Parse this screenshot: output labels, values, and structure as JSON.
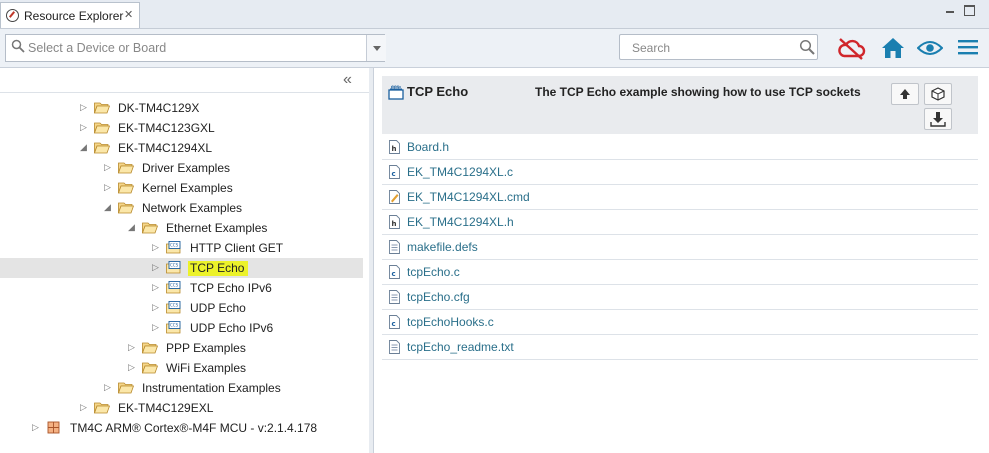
{
  "tab": {
    "title": "Resource Explorer",
    "close_glyph": "✕"
  },
  "window": {
    "minimize_icon": "minimize-icon",
    "maximize_icon": "maximize-icon"
  },
  "toolbar": {
    "device_placeholder": "Select a Device or Board",
    "search_placeholder": "Search",
    "icons": [
      "search-icon",
      "cloud-offline-icon",
      "home-icon",
      "eye-icon",
      "menu-icon"
    ],
    "colors": {
      "accent_blue": "#1a7fb0",
      "cloud_red": "#d0262b"
    }
  },
  "tree": {
    "collapse_glyph": "«",
    "items": [
      {
        "label": "DK-TM4C129X",
        "level": 3,
        "expanded": false,
        "icon": "folder-icon"
      },
      {
        "label": "EK-TM4C123GXL",
        "level": 3,
        "expanded": false,
        "icon": "folder-icon"
      },
      {
        "label": "EK-TM4C1294XL",
        "level": 3,
        "expanded": true,
        "icon": "folder-icon"
      },
      {
        "label": "Driver Examples",
        "level": 4,
        "expanded": false,
        "icon": "folder-icon"
      },
      {
        "label": "Kernel Examples",
        "level": 4,
        "expanded": false,
        "icon": "folder-icon"
      },
      {
        "label": "Network Examples",
        "level": 4,
        "expanded": true,
        "icon": "folder-icon"
      },
      {
        "label": "Ethernet Examples",
        "level": 5,
        "expanded": true,
        "icon": "folder-icon"
      },
      {
        "label": "HTTP Client GET",
        "level": 6,
        "expanded": false,
        "icon": "ccs-project-icon"
      },
      {
        "label": "TCP Echo",
        "level": 6,
        "expanded": false,
        "icon": "ccs-project-icon",
        "selected": true
      },
      {
        "label": "TCP Echo IPv6",
        "level": 6,
        "expanded": false,
        "icon": "ccs-project-icon"
      },
      {
        "label": "UDP Echo",
        "level": 6,
        "expanded": false,
        "icon": "ccs-project-icon"
      },
      {
        "label": "UDP Echo IPv6",
        "level": 6,
        "expanded": false,
        "icon": "ccs-project-icon"
      },
      {
        "label": "PPP Examples",
        "level": 5,
        "expanded": false,
        "icon": "folder-icon"
      },
      {
        "label": "WiFi Examples",
        "level": 5,
        "expanded": false,
        "icon": "folder-icon"
      },
      {
        "label": "Instrumentation Examples",
        "level": 4,
        "expanded": false,
        "icon": "folder-icon"
      },
      {
        "label": "EK-TM4C129EXL",
        "level": 3,
        "expanded": false,
        "icon": "folder-icon"
      },
      {
        "label": "TM4C ARM® Cortex®-M4F MCU - v:2.1.4.178",
        "level": 1,
        "expanded": false,
        "icon": "package-icon"
      }
    ]
  },
  "detail": {
    "title": "TCP Echo",
    "description": "The TCP Echo example showing how to use TCP sockets",
    "buttons": [
      "up-arrow-icon",
      "import-icon",
      "download-icon"
    ],
    "files": [
      {
        "name": "Board.h",
        "icon": "header-file-icon"
      },
      {
        "name": "EK_TM4C1294XL.c",
        "icon": "c-file-icon"
      },
      {
        "name": "EK_TM4C1294XL.cmd",
        "icon": "cmd-file-icon"
      },
      {
        "name": "EK_TM4C1294XL.h",
        "icon": "header-file-icon"
      },
      {
        "name": "makefile.defs",
        "icon": "text-file-icon"
      },
      {
        "name": "tcpEcho.c",
        "icon": "c-file-icon"
      },
      {
        "name": "tcpEcho.cfg",
        "icon": "text-file-icon"
      },
      {
        "name": "tcpEchoHooks.c",
        "icon": "c-file-icon"
      },
      {
        "name": "tcpEcho_readme.txt",
        "icon": "text-file-icon"
      }
    ]
  }
}
